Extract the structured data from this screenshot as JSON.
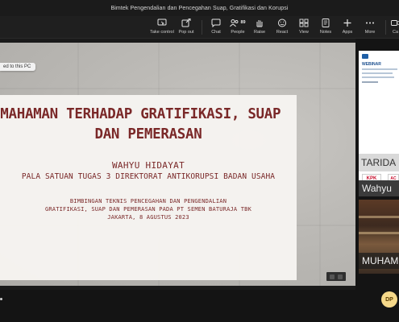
{
  "window": {
    "title": "Bimtek Pengendalian dan Pencegahan Suap, Gratifikasi dan Korupsi"
  },
  "toolbar": {
    "items": [
      {
        "label": "Take control",
        "icon": "take-control-icon"
      },
      {
        "label": "Pop out",
        "icon": "pop-out-icon"
      },
      {
        "label": "Chat",
        "icon": "chat-icon"
      },
      {
        "label": "People",
        "icon": "people-icon",
        "count": "89"
      },
      {
        "label": "Raise",
        "icon": "raise-hand-icon"
      },
      {
        "label": "React",
        "icon": "react-icon"
      },
      {
        "label": "View",
        "icon": "view-icon"
      },
      {
        "label": "Notes",
        "icon": "notes-icon"
      },
      {
        "label": "Apps",
        "icon": "apps-icon"
      },
      {
        "label": "More",
        "icon": "more-icon"
      },
      {
        "label": "Ca",
        "icon": "camera-icon"
      }
    ]
  },
  "stage": {
    "pinned_label": "ed to this PC",
    "slide": {
      "heading_line1": "EMAHAMAN TERHADAP GRATIFIKASI, SUAP",
      "heading_line2": "DAN PEMERASAN",
      "speaker": "WAHYU HIDAYAT",
      "role": "PALA SATUAN TUGAS 3 DIREKTORAT ANTIKORUPSI BADAN USAHA",
      "event_line1": "BIMBINGAN TEKNIS PENCEGAHAN DAN PENGENDALIAN",
      "event_line2": "GRATIFIKASI, SUAP DAN PEMERASAN PADA PT SEMEN BATURAJA TBK",
      "event_line3": "JAKARTA, 8 AGUSTUS 2023"
    }
  },
  "participants": [
    {
      "name": "Wahyu",
      "slide_header": "WEBINAR",
      "banner_name": "TARIDA",
      "logo": "KPK",
      "logo2": "AC SU"
    },
    {
      "name": "MUHAM"
    }
  ],
  "footer": {
    "avatar_initials": "DP"
  },
  "colors": {
    "slide_text": "#7a2828",
    "background": "#141414",
    "avatar": "#f6d98a"
  }
}
